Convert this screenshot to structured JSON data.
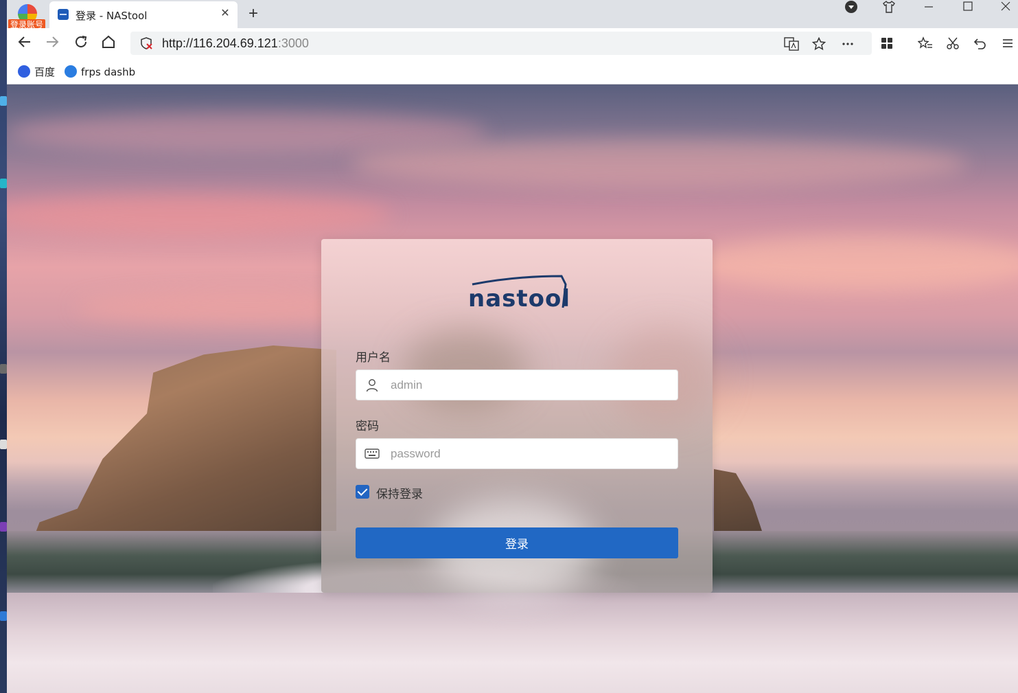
{
  "app_badge": {
    "label": "登录账号"
  },
  "tab": {
    "title": "登录 - NAStool",
    "close": "✕"
  },
  "new_tab": "+",
  "address": {
    "host": "http://116.204.69.121",
    "port": ":3000"
  },
  "bookmarks": [
    {
      "label": "百度",
      "color": "#3060e0"
    },
    {
      "label": "frps dashb",
      "color": "#2a7de1"
    }
  ],
  "login": {
    "brand": "nastool",
    "username_label": "用户名",
    "username_placeholder": "admin",
    "password_label": "密码",
    "password_placeholder": "password",
    "remember_label": "保持登录",
    "remember_checked": true,
    "submit_label": "登录"
  },
  "colors": {
    "accent": "#2168c4",
    "brand": "#1c3a6b",
    "badge": "#ee5a24"
  }
}
